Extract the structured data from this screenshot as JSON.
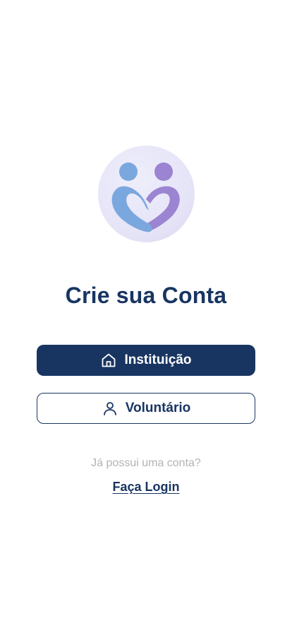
{
  "logo": {
    "icon": "heart-people-logo",
    "colors": {
      "circle": "#e6e4f7",
      "left_figure": "#7ba7df",
      "right_figure": "#9b84d1"
    }
  },
  "title": "Crie sua Conta",
  "buttons": {
    "institution": {
      "label": "Instituição",
      "icon": "home-icon"
    },
    "volunteer": {
      "label": "Voluntário",
      "icon": "user-icon"
    }
  },
  "login_prompt": {
    "question": "Já possui uma conta?",
    "link": "Faça Login"
  },
  "colors": {
    "primary": "#183562",
    "muted_text": "#b3b3b3",
    "background": "#ffffff"
  }
}
